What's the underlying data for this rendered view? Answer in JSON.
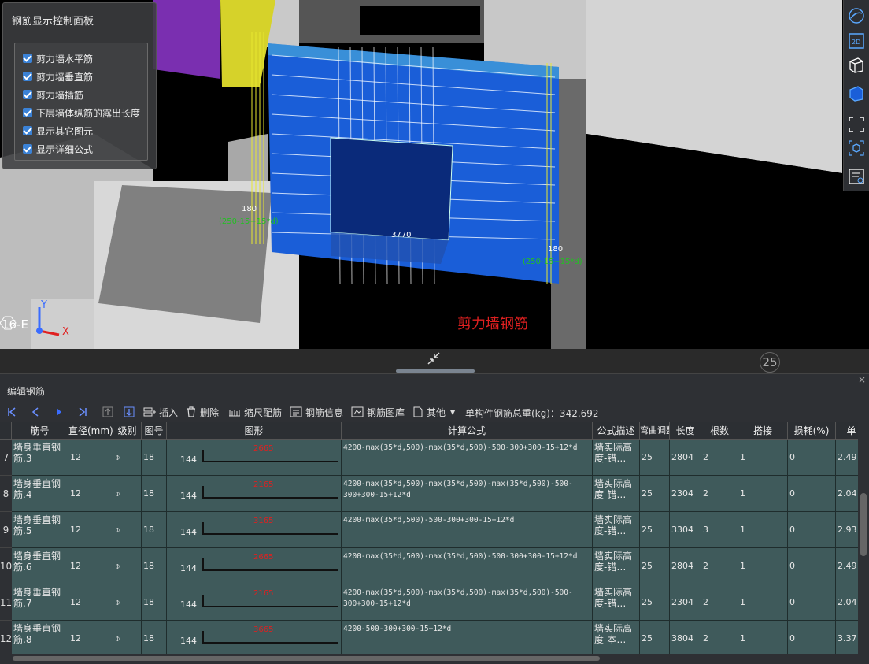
{
  "control_panel": {
    "title": "钢筋显示控制面板",
    "options": [
      {
        "label": "剪力墙水平筋",
        "checked": true
      },
      {
        "label": "剪力墙垂直筋",
        "checked": true
      },
      {
        "label": "剪力墙插筋",
        "checked": true
      },
      {
        "label": "下层墙体纵筋的露出长度",
        "checked": true
      },
      {
        "label": "显示其它图元",
        "checked": true
      },
      {
        "label": "显示详细公式",
        "checked": true
      }
    ]
  },
  "scene": {
    "label": "剪力墙钢筋",
    "dims": {
      "d1": "180",
      "d1_formula": "(250-15+15*d)",
      "d2": "3770",
      "d3": "180",
      "d3_formula": "(250-15+15*d)"
    },
    "axis_label": "16-E",
    "axis_x": "X",
    "axis_y": "Y",
    "badge": "25"
  },
  "right_toolbar": [
    "orbit-icon",
    "2d-view-icon",
    "3d-box-icon",
    "solid-box-icon",
    "fit-view-icon",
    "cube-select-icon",
    "property-list-icon"
  ],
  "editor": {
    "title": "编辑钢筋",
    "close": "×",
    "toolbar": {
      "insert": "插入",
      "delete": "删除",
      "scale": "缩尺配筋",
      "info": "钢筋信息",
      "library": "钢筋图库",
      "other": "其他",
      "total_weight": "单构件钢筋总重(kg)：342.692"
    },
    "columns": [
      "筋号",
      "直径(mm)",
      "级别",
      "图号",
      "图形",
      "计算公式",
      "公式描述",
      "弯曲调整",
      "长度",
      "根数",
      "搭接",
      "损耗(%)",
      "单"
    ],
    "rows": [
      {
        "num": "7",
        "name": "墙身垂直钢筋.3",
        "diameter": "12",
        "grade": "⌽",
        "fig": "18",
        "shape_num": "144",
        "shape_val": "2665",
        "formula": "4200-max(35*d,500)-max(35*d,500)-500-300+300-15+12*d",
        "desc": "墙实际高度-错…",
        "bend": "25",
        "length": "2804",
        "count": "2",
        "lap": "1",
        "loss": "0",
        "unit": "2.49"
      },
      {
        "num": "8",
        "name": "墙身垂直钢筋.4",
        "diameter": "12",
        "grade": "⌽",
        "fig": "18",
        "shape_num": "144",
        "shape_val": "2165",
        "formula": "4200-max(35*d,500)-max(35*d,500)-max(35*d,500)-500-300+300-15+12*d",
        "desc": "墙实际高度-错…",
        "bend": "25",
        "length": "2304",
        "count": "2",
        "lap": "1",
        "loss": "0",
        "unit": "2.04"
      },
      {
        "num": "9",
        "name": "墙身垂直钢筋.5",
        "diameter": "12",
        "grade": "⌽",
        "fig": "18",
        "shape_num": "144",
        "shape_val": "3165",
        "formula": "4200-max(35*d,500)-500-300+300-15+12*d",
        "desc": "墙实际高度-错…",
        "bend": "25",
        "length": "3304",
        "count": "3",
        "lap": "1",
        "loss": "0",
        "unit": "2.93"
      },
      {
        "num": "10",
        "name": "墙身垂直钢筋.6",
        "diameter": "12",
        "grade": "⌽",
        "fig": "18",
        "shape_num": "144",
        "shape_val": "2665",
        "formula": "4200-max(35*d,500)-max(35*d,500)-500-300+300-15+12*d",
        "desc": "墙实际高度-错…",
        "bend": "25",
        "length": "2804",
        "count": "2",
        "lap": "1",
        "loss": "0",
        "unit": "2.49"
      },
      {
        "num": "11",
        "name": "墙身垂直钢筋.7",
        "diameter": "12",
        "grade": "⌽",
        "fig": "18",
        "shape_num": "144",
        "shape_val": "2165",
        "formula": "4200-max(35*d,500)-max(35*d,500)-max(35*d,500)-500-300+300-15+12*d",
        "desc": "墙实际高度-错…",
        "bend": "25",
        "length": "2304",
        "count": "2",
        "lap": "1",
        "loss": "0",
        "unit": "2.04"
      },
      {
        "num": "12",
        "name": "墙身垂直钢筋.8",
        "diameter": "12",
        "grade": "⌽",
        "fig": "18",
        "shape_num": "144",
        "shape_val": "3665",
        "formula": "4200-500-300+300-15+12*d",
        "desc": "墙实际高度-本…",
        "bend": "25",
        "length": "3804",
        "count": "2",
        "lap": "1",
        "loss": "0",
        "unit": "3.37"
      }
    ]
  }
}
